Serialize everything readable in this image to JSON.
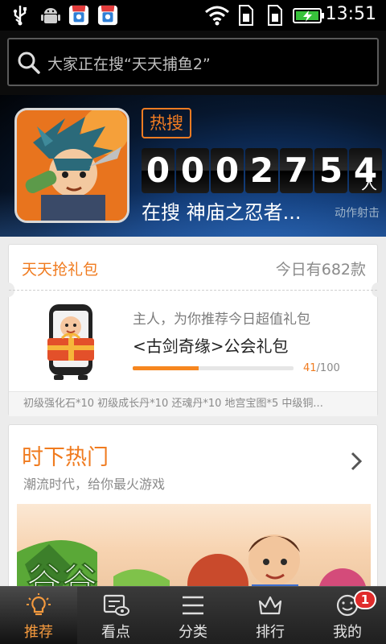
{
  "status_bar": {
    "time": "13:51",
    "icons": [
      "usb-icon",
      "android-debug-icon",
      "app-notify-icon",
      "app-notify-icon",
      "wifi-icon",
      "sim-icon",
      "sim-icon",
      "battery-charging-icon"
    ]
  },
  "search": {
    "placeholder": "大家正在搜“天天捕鱼2”"
  },
  "hero": {
    "badge": "热搜",
    "digits": [
      "0",
      "0",
      "0",
      "2",
      "7",
      "5",
      "4"
    ],
    "unit": "人",
    "searching_text": "在搜 神庙之忍者...",
    "genre": "动作射击"
  },
  "gift": {
    "title": "天天抢礼包",
    "today_count": "今日有682款",
    "subtitle": "主人，为你推荐今日超值礼包",
    "name": "<古剑奇缘>公会礼包",
    "progress_current": "41",
    "progress_total": "/100",
    "progress_fraction": 0.41,
    "items": "初级强化石*10 初级成长丹*10  还魂丹*10 地宫宝图*5 中级铜..."
  },
  "hot": {
    "title": "时下热门",
    "subtitle": "潮流时代，给你最火游戏"
  },
  "nav": {
    "items": [
      {
        "label": "推荐",
        "icon": "lightbulb-icon"
      },
      {
        "label": "看点",
        "icon": "watch-icon"
      },
      {
        "label": "分类",
        "icon": "menu-icon"
      },
      {
        "label": "排行",
        "icon": "crown-icon"
      },
      {
        "label": "我的",
        "icon": "smiley-icon"
      }
    ],
    "badge": "1"
  },
  "colors": {
    "accent": "#f07b1f",
    "nav_active": "#f59a3e",
    "badge": "#e02b2b"
  }
}
